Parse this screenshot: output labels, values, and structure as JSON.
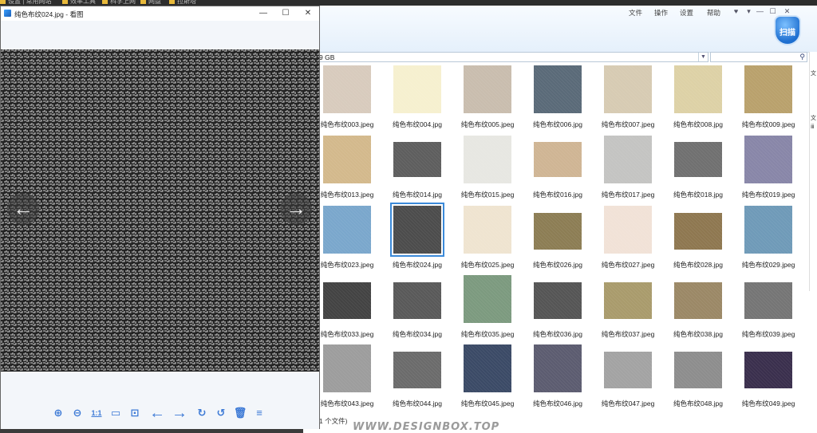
{
  "taskbar": {
    "bookmarks": [
      {
        "label": "设置 | 常用网站"
      },
      {
        "label": "效率工具"
      },
      {
        "label": "科学上网"
      },
      {
        "label": "网盘"
      },
      {
        "label": "拉斯塔"
      }
    ]
  },
  "explorer": {
    "menu": [
      "文件",
      "操作",
      "设置",
      "帮助"
    ],
    "address_value": "9 GB",
    "search_placeholder": "",
    "shield_label": "扫描",
    "status_text": "1 个文件)",
    "right_strip": [
      "文",
      "文",
      "ⅲ"
    ],
    "files": [
      {
        "name": "纯色布纹003.jpeg",
        "color": "#d8cbbd",
        "selected": false
      },
      {
        "name": "纯色布纹004.jpg",
        "color": "#f6f0cf",
        "selected": false
      },
      {
        "name": "纯色布纹005.jpeg",
        "color": "#c9bdae",
        "selected": false
      },
      {
        "name": "纯色布纹006.jpg",
        "color": "#5a6a78",
        "selected": false
      },
      {
        "name": "纯色布纹007.jpeg",
        "color": "#d7cbb3",
        "selected": false
      },
      {
        "name": "纯色布纹008.jpg",
        "color": "#ddd1a6",
        "selected": false
      },
      {
        "name": "纯色布纹009.jpeg",
        "color": "#b9a16c",
        "selected": false
      },
      {
        "name": "纯色布纹013.jpeg",
        "color": "#d3b98c",
        "selected": false
      },
      {
        "name": "纯色布纹014.jpg",
        "color": "#5e5e5e",
        "selected": false
      },
      {
        "name": "纯色布纹015.jpeg",
        "color": "#e7e7e2",
        "selected": false
      },
      {
        "name": "纯色布纹016.jpg",
        "color": "#cfb594",
        "selected": false
      },
      {
        "name": "纯色布纹017.jpeg",
        "color": "#c4c4c2",
        "selected": false
      },
      {
        "name": "纯色布纹018.jpg",
        "color": "#707070",
        "selected": false
      },
      {
        "name": "纯色布纹019.jpeg",
        "color": "#8886a8",
        "selected": false
      },
      {
        "name": "纯色布纹023.jpeg",
        "color": "#7aa7cc",
        "selected": false
      },
      {
        "name": "纯色布纹024.jpg",
        "color": "#4c4c4c",
        "selected": true
      },
      {
        "name": "纯色布纹025.jpeg",
        "color": "#efe4d0",
        "selected": false
      },
      {
        "name": "纯色布纹026.jpg",
        "color": "#8c7d54",
        "selected": false
      },
      {
        "name": "纯色布纹027.jpeg",
        "color": "#f1e2d7",
        "selected": false
      },
      {
        "name": "纯色布纹028.jpg",
        "color": "#8e7750",
        "selected": false
      },
      {
        "name": "纯色布纹029.jpeg",
        "color": "#6f9ab8",
        "selected": false
      },
      {
        "name": "纯色布纹033.jpeg",
        "color": "#434343",
        "selected": false
      },
      {
        "name": "纯色布纹034.jpg",
        "color": "#595959",
        "selected": false
      },
      {
        "name": "纯色布纹035.jpeg",
        "color": "#7c9a7f",
        "selected": false
      },
      {
        "name": "纯色布纹036.jpg",
        "color": "#555555",
        "selected": false
      },
      {
        "name": "纯色布纹037.jpeg",
        "color": "#a99b6c",
        "selected": false
      },
      {
        "name": "纯色布纹038.jpg",
        "color": "#9b8866",
        "selected": false
      },
      {
        "name": "纯色布纹039.jpeg",
        "color": "#757575",
        "selected": false
      },
      {
        "name": "纯色布纹043.jpeg",
        "color": "#9d9d9d",
        "selected": false
      },
      {
        "name": "纯色布纹044.jpg",
        "color": "#6b6b6b",
        "selected": false
      },
      {
        "name": "纯色布纹045.jpeg",
        "color": "#3b4a66",
        "selected": false
      },
      {
        "name": "纯色布纹046.jpg",
        "color": "#5c5c70",
        "selected": false
      },
      {
        "name": "纯色布纹047.jpeg",
        "color": "#a3a3a3",
        "selected": false
      },
      {
        "name": "纯色布纹048.jpg",
        "color": "#8d8d8d",
        "selected": false
      },
      {
        "name": "纯色布纹049.jpeg",
        "color": "#3a2f4d",
        "selected": false
      }
    ]
  },
  "viewer": {
    "title": "纯色布纹024.jpg - 看图",
    "controls": {
      "minimize": "—",
      "maximize": "☐",
      "close": "✕"
    },
    "prev_glyph": "←",
    "next_glyph": "→",
    "toolbar": [
      {
        "name": "zoom-in-icon",
        "glyph": "⊕"
      },
      {
        "name": "zoom-out-icon",
        "glyph": "⊖"
      },
      {
        "name": "actual-size-button",
        "glyph": "1:1"
      },
      {
        "name": "open-folder-icon",
        "glyph": "▭"
      },
      {
        "name": "slideshow-icon",
        "glyph": "⊡"
      },
      {
        "name": "prev-image-icon",
        "glyph": "←"
      },
      {
        "name": "next-image-icon",
        "glyph": "→"
      },
      {
        "name": "rotate-right-icon",
        "glyph": "↻"
      },
      {
        "name": "rotate-left-icon",
        "glyph": "↺"
      },
      {
        "name": "delete-icon",
        "glyph": "🗑"
      },
      {
        "name": "more-menu-icon",
        "glyph": "≡"
      }
    ]
  },
  "watermark": "WWW.DESIGNBOX.TOP"
}
